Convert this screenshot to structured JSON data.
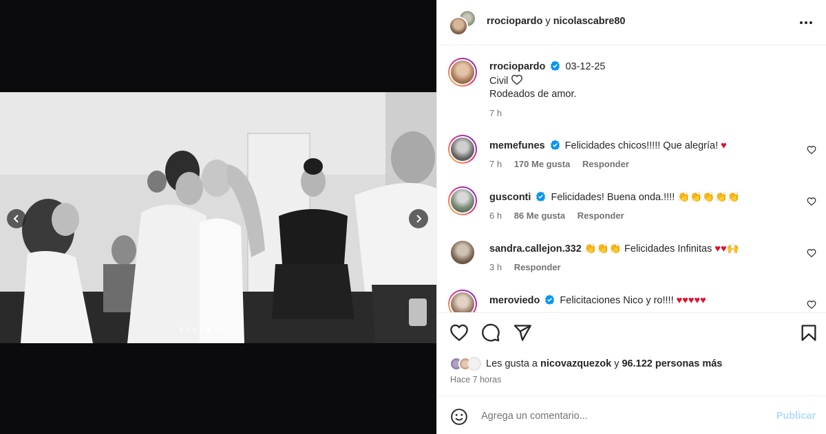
{
  "header": {
    "user1": "rrociopardo",
    "separator": "y",
    "user2": "nicolascabre80"
  },
  "caption": {
    "username": "rrociopardo",
    "date": "03-12-25",
    "line1": "Civil",
    "line2": "Rodeados de amor.",
    "time": "7 h"
  },
  "comments": [
    {
      "username": "memefunes",
      "verified": true,
      "text": "Felicidades chicos!!!!! Que alegría!",
      "emoji": "♥",
      "time": "7 h",
      "likes": "170 Me gusta",
      "reply": "Responder"
    },
    {
      "username": "gusconti",
      "verified": true,
      "text": "Felicidades! Buena onda.!!!!",
      "emoji": "👏👏👏👏👏",
      "time": "6 h",
      "likes": "86 Me gusta",
      "reply": "Responder"
    },
    {
      "username": "sandra.callejon.332",
      "verified": false,
      "lead_emoji": "👏👏👏",
      "text": "Felicidades Infinitas",
      "emoji": "♥♥🙌",
      "time": "3 h",
      "reply": "Responder"
    },
    {
      "username": "meroviedo",
      "verified": true,
      "text": "Felicitaciones Nico y ro!!!!",
      "emoji": "♥♥♥♥♥"
    }
  ],
  "likes": {
    "prefix": "Les gusta a",
    "user": "nicovazquezok",
    "connector": "y",
    "others": "96.122 personas más"
  },
  "time_ago": "Hace 7 horas",
  "comment_box": {
    "placeholder": "Agrega un comentario...",
    "post_label": "Publicar"
  },
  "carousel": {
    "total_slides": 9,
    "active_slide": 5
  },
  "colors": {
    "verified": "#0095f6",
    "heart": "#e0102d",
    "post_disabled": "#b3dbff",
    "secondary_text": "#737373"
  }
}
